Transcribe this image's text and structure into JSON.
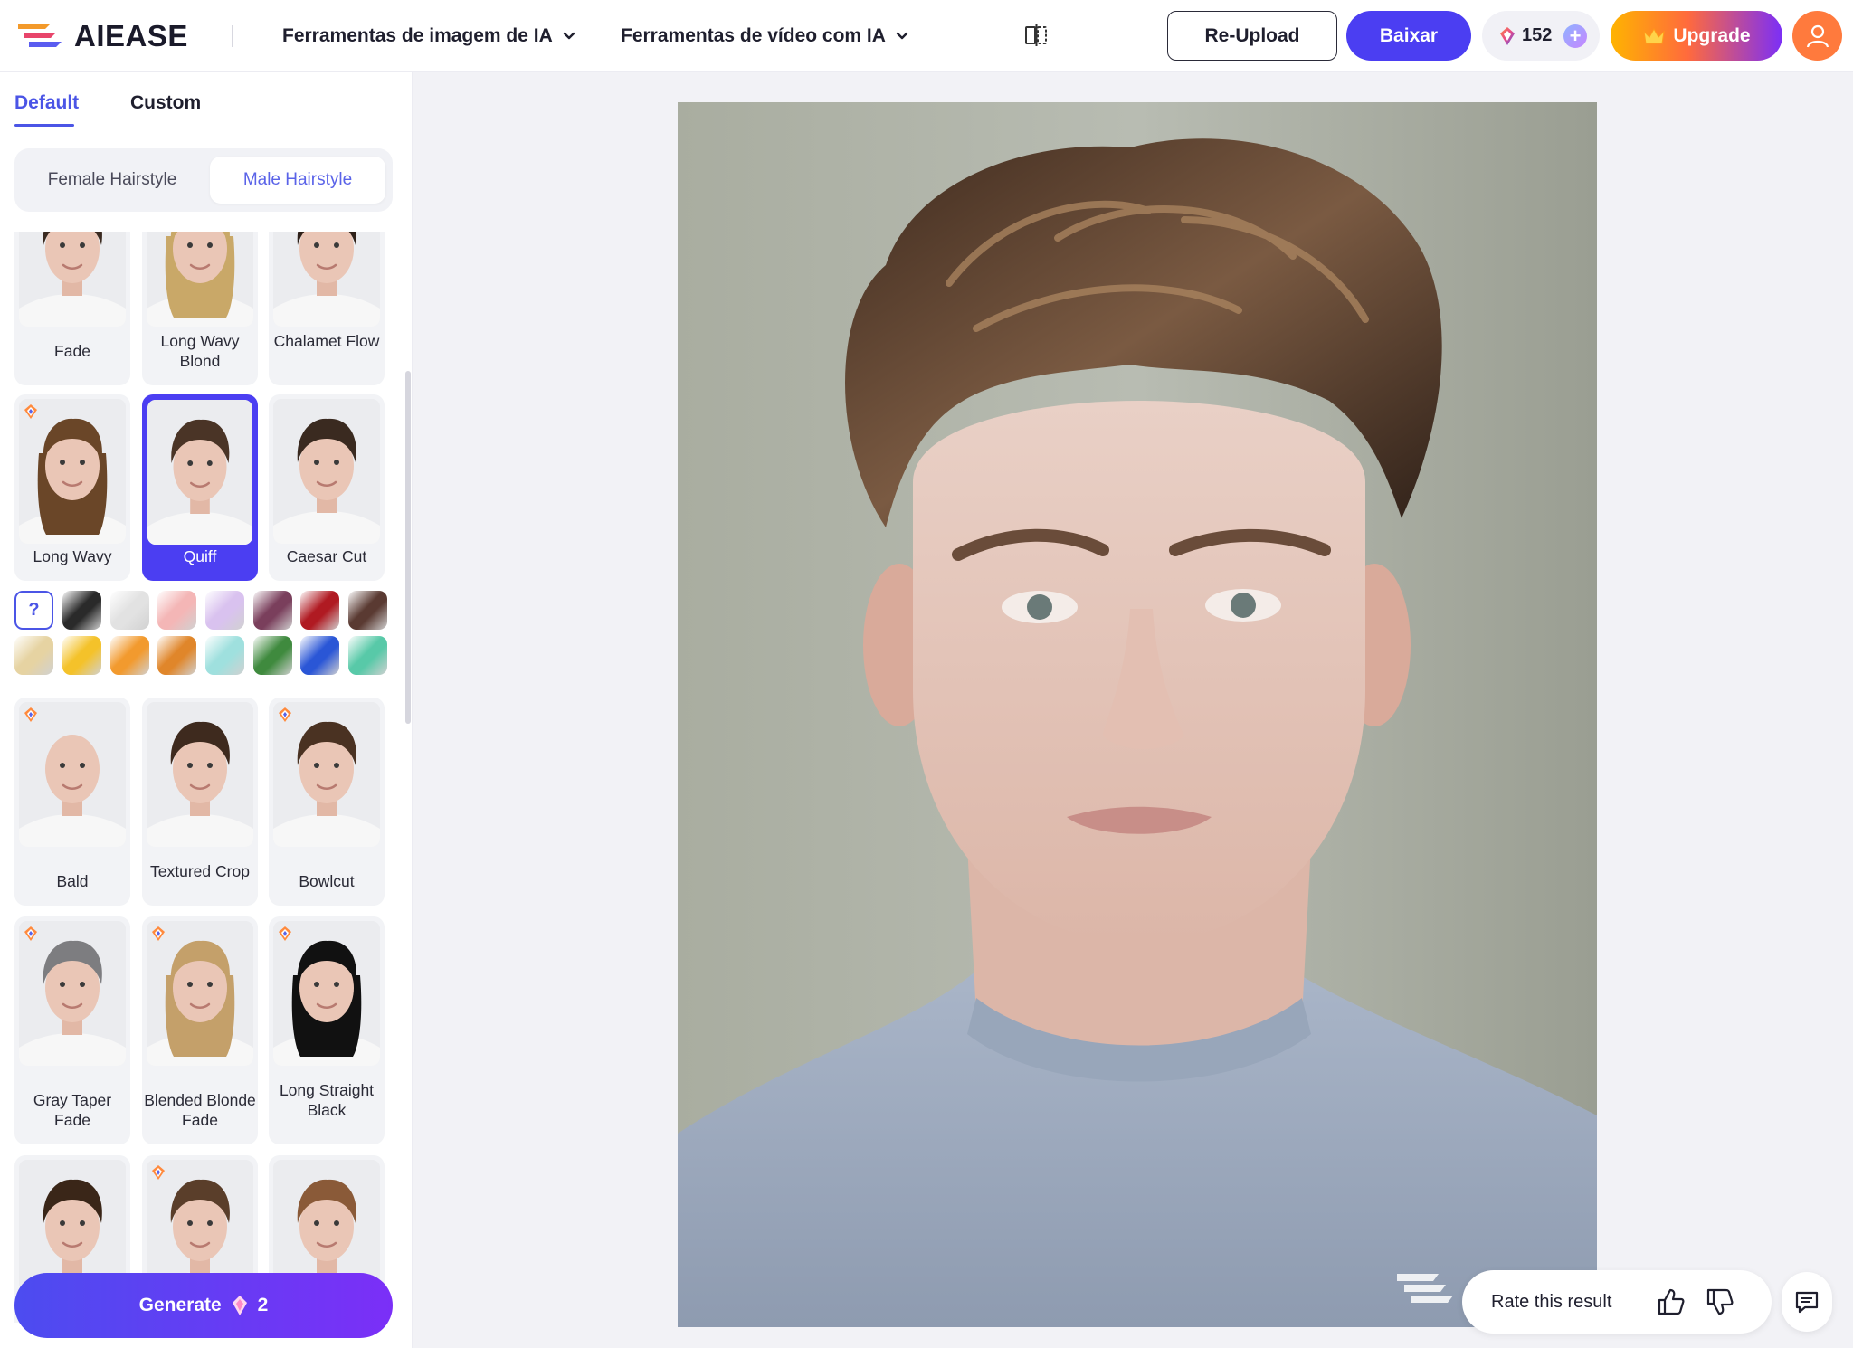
{
  "header": {
    "logo_text": "AIEASE",
    "nav": [
      {
        "label": "Ferramentas de imagem de IA"
      },
      {
        "label": "Ferramentas de vídeo com IA"
      }
    ],
    "reupload_label": "Re-Upload",
    "download_label": "Baixar",
    "credits": "152",
    "upgrade_label": "Upgrade"
  },
  "sidebar": {
    "tabs": [
      {
        "label": "Default",
        "active": true
      },
      {
        "label": "Custom",
        "active": false
      }
    ],
    "segments": [
      {
        "label": "Female Hairstyle",
        "active": false
      },
      {
        "label": "Male Hairstyle",
        "active": true
      }
    ],
    "styles": [
      {
        "name": "Fade",
        "pro": false,
        "selected": false,
        "hair": "#3a2a20"
      },
      {
        "name": "Long Wavy Blond",
        "pro": false,
        "selected": false,
        "hair": "#c9a868"
      },
      {
        "name": "Chalamet Flow",
        "pro": false,
        "selected": false,
        "hair": "#2e2018"
      },
      {
        "name": "Long Wavy",
        "pro": true,
        "selected": false,
        "hair": "#6a4628"
      },
      {
        "name": "Quiff",
        "pro": false,
        "selected": true,
        "hair": "#4a3426"
      },
      {
        "name": "Caesar Cut",
        "pro": false,
        "selected": false,
        "hair": "#3a2a20"
      },
      {
        "name": "Bald",
        "pro": true,
        "selected": false,
        "hair": "#e7c7b6"
      },
      {
        "name": "Textured Crop",
        "pro": false,
        "selected": false,
        "hair": "#3e2a1e"
      },
      {
        "name": "Bowlcut",
        "pro": true,
        "selected": false,
        "hair": "#4a3222"
      },
      {
        "name": "Gray Taper Fade",
        "pro": true,
        "selected": false,
        "hair": "#7d7d80"
      },
      {
        "name": "Blended Blonde Fade",
        "pro": true,
        "selected": false,
        "hair": "#c4a06a"
      },
      {
        "name": "Long Straight Black",
        "pro": true,
        "selected": false,
        "hair": "#111111"
      },
      {
        "name": "",
        "pro": false,
        "selected": false,
        "hair": "#3a2618"
      },
      {
        "name": "",
        "pro": true,
        "selected": false,
        "hair": "#5a3e2a"
      },
      {
        "name": "",
        "pro": false,
        "selected": false,
        "hair": "#8a5a38"
      }
    ],
    "color_none_label": "?",
    "colors": [
      "#2a2a2a",
      "#e2e2e2",
      "#f4b6b6",
      "#d9c2ef",
      "#7a3f5c",
      "#b01a22",
      "#5a3a32",
      "#e6d3a2",
      "#f4c22a",
      "#f29a2e",
      "#e0862a",
      "#9fe0de",
      "#3f8a3e",
      "#2a56d6",
      "#58c9a8"
    ],
    "generate_label": "Generate",
    "generate_cost": "2"
  },
  "canvas": {
    "rate_label": "Rate this result"
  },
  "colors": {
    "accent": "#4b3ef2",
    "tab_active": "#4b55e6"
  }
}
